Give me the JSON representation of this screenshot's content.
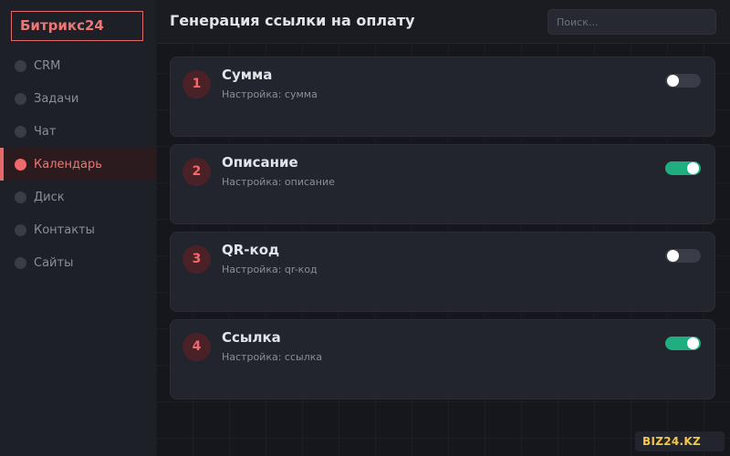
{
  "app": {
    "logo": "Битрикс24"
  },
  "sidebar": {
    "items": [
      {
        "label": "CRM",
        "active": false
      },
      {
        "label": "Задачи",
        "active": false
      },
      {
        "label": "Чат",
        "active": false
      },
      {
        "label": "Календарь",
        "active": true
      },
      {
        "label": "Диск",
        "active": false
      },
      {
        "label": "Контакты",
        "active": false
      },
      {
        "label": "Сайты",
        "active": false
      }
    ]
  },
  "header": {
    "title": "Генерация ссылки на оплату",
    "search_placeholder": "Поиск..."
  },
  "cards": [
    {
      "number": "1",
      "title": "Сумма",
      "subtitle": "Настройка: сумма",
      "enabled": false
    },
    {
      "number": "2",
      "title": "Описание",
      "subtitle": "Настройка: описание",
      "enabled": true
    },
    {
      "number": "3",
      "title": "QR-код",
      "subtitle": "Настройка: qr-код",
      "enabled": false
    },
    {
      "number": "4",
      "title": "Ссылка",
      "subtitle": "Настройка: ссылка",
      "enabled": true
    }
  ],
  "footer": {
    "brand": "BIZ24.KZ"
  },
  "colors": {
    "accent": "#ef6b6b",
    "toggle_on": "#1fae7f",
    "toggle_off": "#3a3d47",
    "brand_badge_text": "#f3c846"
  }
}
